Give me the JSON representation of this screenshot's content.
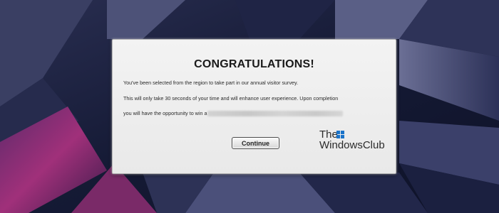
{
  "dialog": {
    "title": "CONGRATULATIONS!",
    "line1": "You've been selected from the region to take part in our annual visitor survey.",
    "line2": "This will only take 30 seconds of your time and will enhance user experience. Upon completion",
    "line3": "you will have the opportunity to win a",
    "continue_label": "Continue"
  },
  "watermark": {
    "line1": "The",
    "line2": "WindowsClub",
    "logo_icon": "windowsclub-logo-icon",
    "logo_color": "#1a73c9"
  },
  "colors": {
    "dialog_bg": "#efefef",
    "wallpaper_dark": "#151a35",
    "wallpaper_accent": "#9a2e77"
  }
}
